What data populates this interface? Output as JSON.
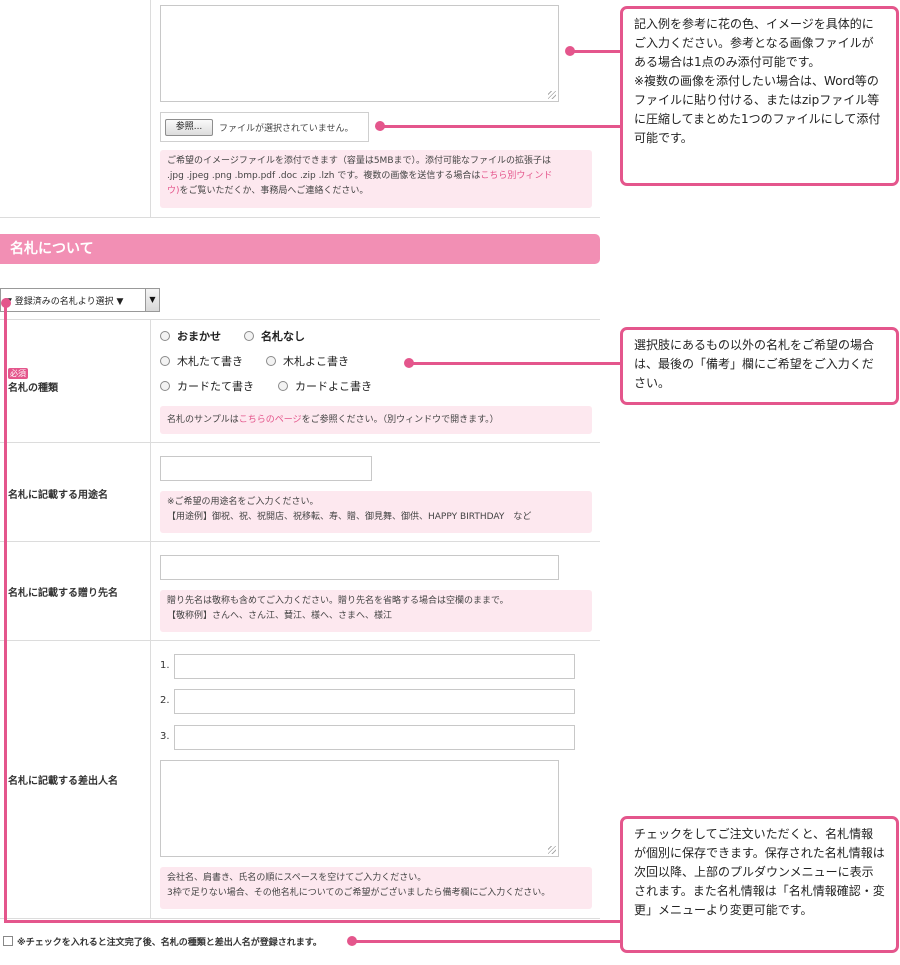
{
  "file_upload": {
    "browse_button": "参照...",
    "status": "ファイルが選択されていません。",
    "note_line1": "ご希望のイメージファイルを添付できます（容量は5MBまで）。添付可能なファイルの拡張子は",
    "note_line2": ".jpg .jpeg .png .bmp.pdf .doc .zip .lzh です。複数の画像を送信する場合は",
    "note_link": "こちら別ウィンド",
    "note_line3_link": "ウ)",
    "note_line3": "をご覧いただくか、事務局へご連絡ください。"
  },
  "section": {
    "title": "名札について"
  },
  "name_select": {
    "value": "▼ 登録済みの名札より選択 ▼"
  },
  "tag_type": {
    "required": "必須",
    "label": "名札の種類",
    "options": [
      "おまかせ",
      "名札なし",
      "木札たて書き",
      "木札よこ書き",
      "カードたて書き",
      "カードよこ書き"
    ],
    "note_pre": "名札のサンプルは",
    "note_link": "こちらのページ",
    "note_post": "をご参照ください。（別ウィンドウで開きます。）"
  },
  "purpose": {
    "label": "名札に記載する用途名",
    "note_line1": "※ご希望の用途名をご入力ください。",
    "note_line2": "【用途例】御祝、祝、祝開店、祝移転、寿、贈、御見舞、御供、HAPPY BIRTHDAY　など"
  },
  "recipient": {
    "label": "名札に記載する贈り先名",
    "note_line1": "贈り先名は敬称も含めてご入力ください。贈り先名を省略する場合は空欄のままで。",
    "note_line2": "【敬称例】さんへ、さん江、賛江、様へ、さまへ、様江"
  },
  "sender": {
    "label": "名札に記載する差出人名",
    "rows": [
      "1.",
      "2.",
      "3."
    ],
    "note_line1": "会社名、肩書き、氏名の順にスペースを空けてご入力ください。",
    "note_line2": "3枠で足りない場合、その他名札についてのご希望がございましたら備考欄にご入力ください。"
  },
  "save_check": {
    "label": "※チェックを入れると注文完了後、名札の種類と差出人名が登録されます。"
  },
  "callouts": {
    "c1": "記入例を参考に花の色、イメージを具体的にご入力ください。参考となる画像ファイルがある場合は1点のみ添付可能です。\n※複数の画像を添付したい場合は、Word等のファイルに貼り付ける、またはzipファイル等に圧縮してまとめた1つのファイルにして添付可能です。",
    "c2": "選択肢にあるもの以外の名札をご希望の場合は、最後の「備考」欄にご希望をご入力ください。",
    "c3": "チェックをしてご注文いただくと、名札情報が個別に保存できます。保存された名札情報は次回以降、上部のプルダウンメニューに表示されます。また名札情報は「名札情報確認・変更」メニューより変更可能です。"
  },
  "colors": {
    "accent": "#e4568c",
    "section_bar": "#f28fb4",
    "note_bg": "#fde8ef"
  }
}
